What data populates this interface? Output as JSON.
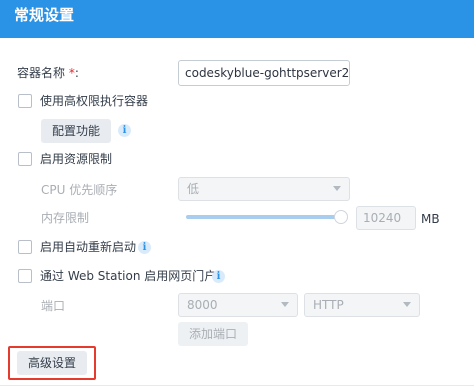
{
  "header": {
    "title": "常规设置"
  },
  "container_name": {
    "label": "容器名称",
    "required_mark": "*",
    "colon": ":",
    "value": "codeskyblue-gohttpserver2"
  },
  "high_privilege": {
    "label": "使用高权限执行容器",
    "checked": false
  },
  "configure_capabilities": {
    "button_label": "配置功能",
    "info_glyph": "i"
  },
  "resource_limit": {
    "label": "启用资源限制",
    "checked": false,
    "cpu_priority": {
      "label": "CPU 优先顺序",
      "selected": "低"
    },
    "memory_limit": {
      "label": "内存限制",
      "slider_fraction": 1.0,
      "value": "10240",
      "unit": "MB"
    }
  },
  "auto_restart": {
    "label": "启用自动重新启动",
    "checked": false,
    "info_glyph": "i"
  },
  "web_portal": {
    "label": "通过 Web Station 启用网页门户",
    "checked": false,
    "info_glyph": "i",
    "port": {
      "label": "端口",
      "selected": "8000"
    },
    "protocol": {
      "selected": "HTTP"
    },
    "add_port_button": "添加端口"
  },
  "advanced_settings": {
    "button_label": "高级设置"
  },
  "colors": {
    "header_bg": "#2b93e6",
    "required": "#e4292f",
    "highlight": "#e53a2e"
  }
}
